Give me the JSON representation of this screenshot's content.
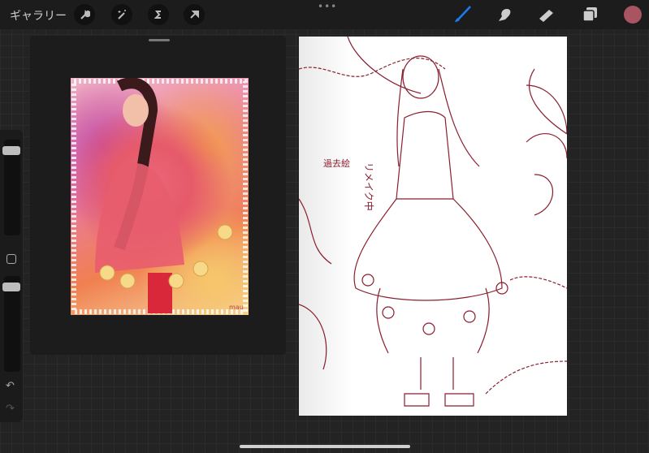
{
  "toolbar": {
    "gallery_label": "ギャラリー",
    "more_label": "•••",
    "left_tools": [
      "wrench-icon",
      "magic-wand-icon",
      "selection-icon",
      "transform-arrow-icon"
    ],
    "right_tools": [
      "brush-icon",
      "smudge-icon",
      "eraser-icon",
      "layers-icon"
    ],
    "active_tool": "brush",
    "active_tool_color": "#1a7cf0",
    "current_color": "#a85461"
  },
  "sidebar": {
    "undo": "↶",
    "redo": "↷",
    "brush_size": 0.95,
    "opacity": 0.95
  },
  "canvas": {
    "note_1": "リメイク中",
    "note_2": "過去絵",
    "line_color": "#8b1e2e"
  },
  "reference": {
    "signature": "mau"
  }
}
